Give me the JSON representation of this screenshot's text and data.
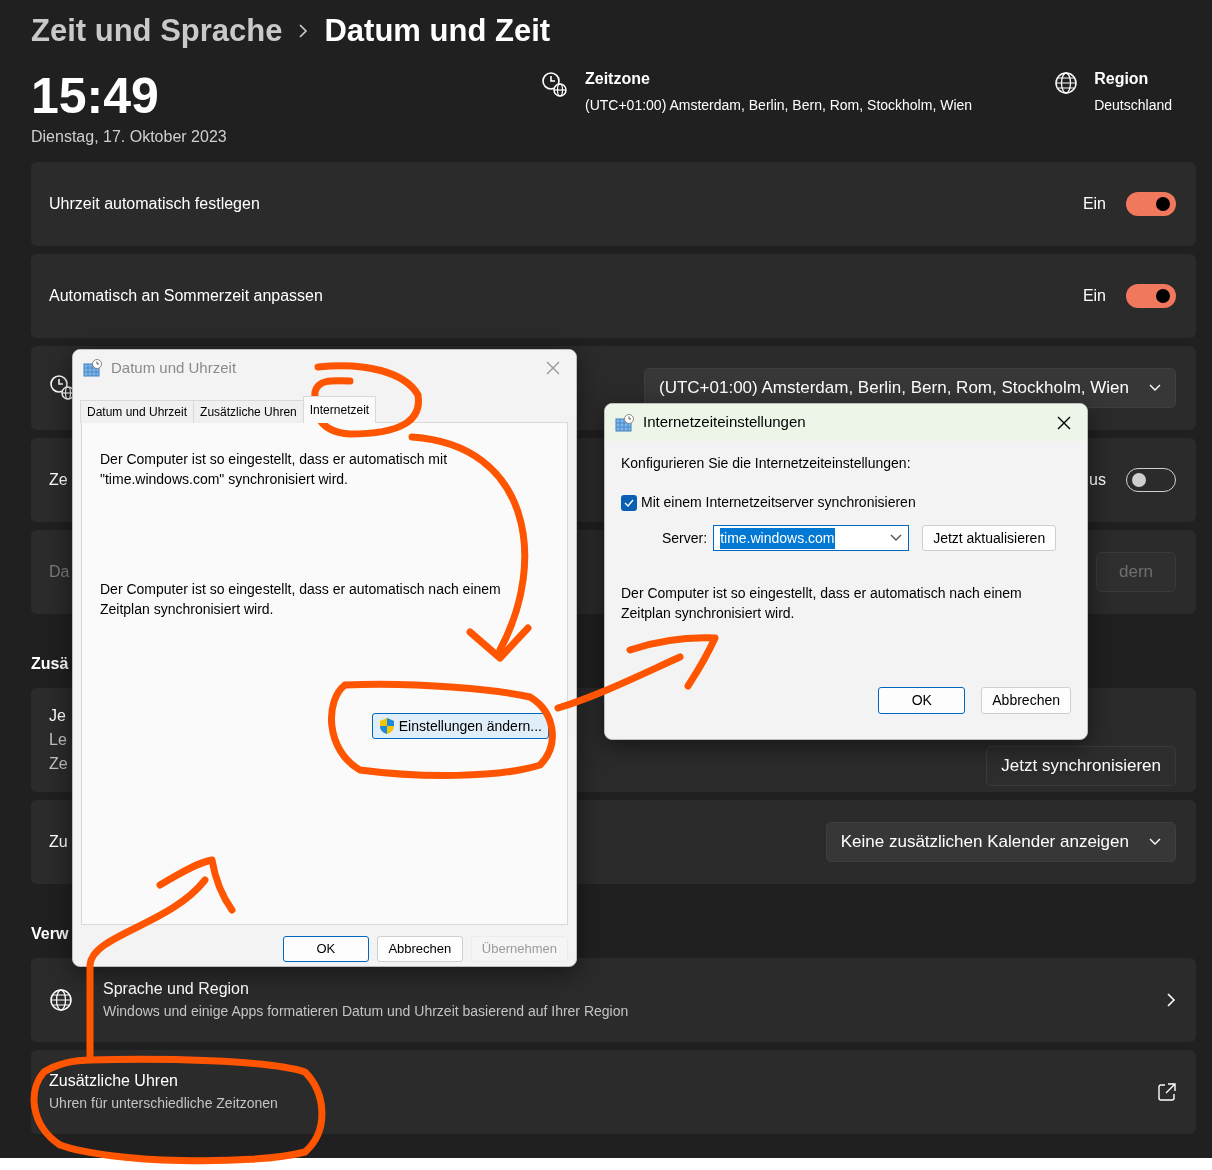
{
  "breadcrumb": {
    "parent": "Zeit und Sprache",
    "current": "Datum und Zeit"
  },
  "clock": {
    "time": "15:49",
    "date": "Dienstag, 17. Oktober 2023"
  },
  "info": [
    {
      "kind": "timezone",
      "label": "Zeitzone",
      "value": "(UTC+01:00) Amsterdam, Berlin, Bern, Rom, Stockholm, Wien"
    },
    {
      "kind": "region",
      "label": "Region",
      "value": "Deutschland"
    }
  ],
  "sections": [
    {
      "cards": [
        {
          "kind": "toggle",
          "title": "Uhrzeit automatisch festlegen",
          "state_label": "Ein",
          "on": true
        },
        {
          "kind": "toggle",
          "title": "Automatisch an Sommerzeit anpassen",
          "state_label": "Ein",
          "on": true
        },
        {
          "kind": "icon_dropdown",
          "value": "(UTC+01:00) Amsterdam, Berlin, Bern, Rom, Stockholm, Wien"
        },
        {
          "kind": "toggle",
          "title": "Ze",
          "state_label": "us",
          "on": false
        },
        {
          "kind": "button",
          "title": "Da",
          "button": "dern",
          "disabled": true
        }
      ]
    },
    {
      "heading": "Zusä",
      "cards": [
        {
          "kind": "multiline",
          "title": "Je",
          "lines": [
            "Le",
            "Ze"
          ],
          "button": "Jetzt synchronisieren"
        },
        {
          "kind": "dropdown",
          "title": "Zu",
          "value": "Keine zusätzlichen Kalender anzeigen"
        }
      ]
    },
    {
      "heading": "Verw",
      "cards": [
        {
          "kind": "link",
          "title": "Sprache und Region",
          "subtitle": "Windows und einige Apps formatieren Datum und Uhrzeit basierend auf Ihrer Region"
        },
        {
          "kind": "external",
          "title": "Zusätzliche Uhren",
          "subtitle": "Uhren für unterschiedliche Zeitzonen"
        }
      ]
    }
  ],
  "dialog": {
    "title": "Datum und Uhrzeit",
    "active": false,
    "tabs": [
      {
        "label": "Datum und Uhrzeit",
        "selected": false
      },
      {
        "label": "Zusätzliche Uhren",
        "selected": false
      },
      {
        "label": "Internetzeit",
        "selected": true
      }
    ],
    "paragraphs": [
      "Der Computer ist so eingestellt, dass er automatisch mit \"time.windows.com\" synchronisiert wird.",
      "Der Computer ist so eingestellt, dass er automatisch nach einem Zeitplan synchronisiert wird."
    ],
    "change_button": "Einstellungen ändern...",
    "buttons": [
      {
        "label": "OK",
        "default": true,
        "disabled": false
      },
      {
        "label": "Abbrechen",
        "default": false,
        "disabled": false
      },
      {
        "label": "Übernehmen",
        "default": false,
        "disabled": true
      }
    ]
  },
  "internet_dialog": {
    "title": "Internetzeiteinstellungen",
    "active": true,
    "intro": "Konfigurieren Sie die Internetzeiteinstellungen:",
    "sync": {
      "label": "Mit einem Internetzeitserver synchronisieren",
      "checked": true
    },
    "server": {
      "label": "Server:",
      "value": "time.windows.com",
      "text_selected": true
    },
    "update_button": "Jetzt aktualisieren",
    "note": "Der Computer ist so eingestellt, dass er automatisch nach einem Zeitplan synchronisiert wird.",
    "buttons": [
      {
        "label": "OK",
        "default": true
      },
      {
        "label": "Abbrechen",
        "default": false
      }
    ]
  }
}
